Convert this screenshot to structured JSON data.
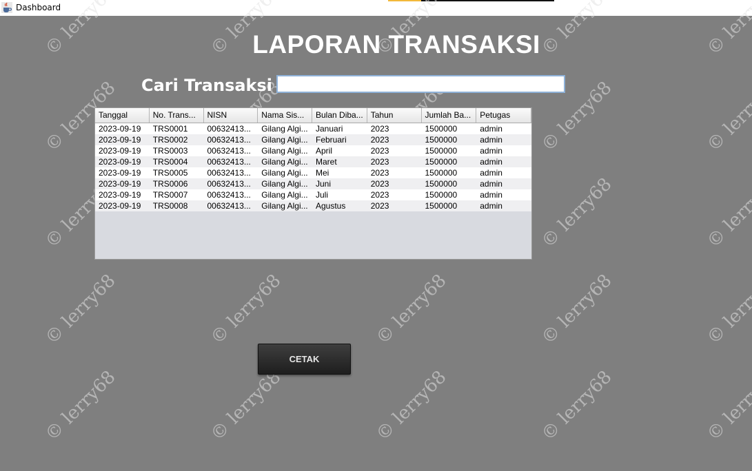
{
  "window": {
    "title": "Dashboard"
  },
  "page": {
    "title": "LAPORAN TRANSAKSI"
  },
  "search": {
    "label": "Cari Transaksi :",
    "value": ""
  },
  "table": {
    "columns": [
      "Tanggal",
      "No. Trans...",
      "NISN",
      "Nama Sis...",
      "Bulan Diba...",
      "Tahun",
      "Jumlah Ba...",
      "Petugas"
    ],
    "rows": [
      [
        "2023-09-19",
        "TRS0001",
        "00632413...",
        "Gilang Algi...",
        "Januari",
        "2023",
        "1500000",
        "admin"
      ],
      [
        "2023-09-19",
        "TRS0002",
        "00632413...",
        "Gilang Algi...",
        "Februari",
        "2023",
        "1500000",
        "admin"
      ],
      [
        "2023-09-19",
        "TRS0003",
        "00632413...",
        "Gilang Algi...",
        "April",
        "2023",
        "1500000",
        "admin"
      ],
      [
        "2023-09-19",
        "TRS0004",
        "00632413...",
        "Gilang Algi...",
        "Maret",
        "2023",
        "1500000",
        "admin"
      ],
      [
        "2023-09-19",
        "TRS0005",
        "00632413...",
        "Gilang Algi...",
        "Mei",
        "2023",
        "1500000",
        "admin"
      ],
      [
        "2023-09-19",
        "TRS0006",
        "00632413...",
        "Gilang Algi...",
        "Juni",
        "2023",
        "1500000",
        "admin"
      ],
      [
        "2023-09-19",
        "TRS0007",
        "00632413...",
        "Gilang Algi...",
        "Juli",
        "2023",
        "1500000",
        "admin"
      ],
      [
        "2023-09-19",
        "TRS0008",
        "00632413...",
        "Gilang Algi...",
        "Agustus",
        "2023",
        "1500000",
        "admin"
      ]
    ]
  },
  "actions": {
    "print_label": "CETAK"
  },
  "watermark": {
    "text": "© lerry68"
  },
  "icons": {
    "app": "java-cup-icon"
  }
}
